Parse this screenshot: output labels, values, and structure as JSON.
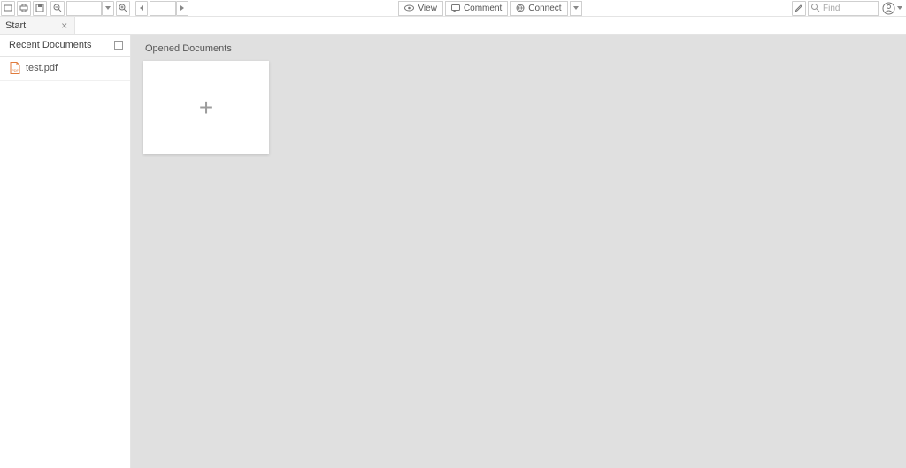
{
  "toolbar": {
    "zoom_value": "",
    "page_value": "",
    "modes": {
      "view": "View",
      "comment": "Comment",
      "connect": "Connect"
    },
    "find_placeholder": "Find"
  },
  "tabs": [
    {
      "label": "Start"
    }
  ],
  "sidebar": {
    "title": "Recent Documents",
    "items": [
      {
        "name": "test.pdf"
      }
    ]
  },
  "content": {
    "title": "Opened Documents"
  }
}
